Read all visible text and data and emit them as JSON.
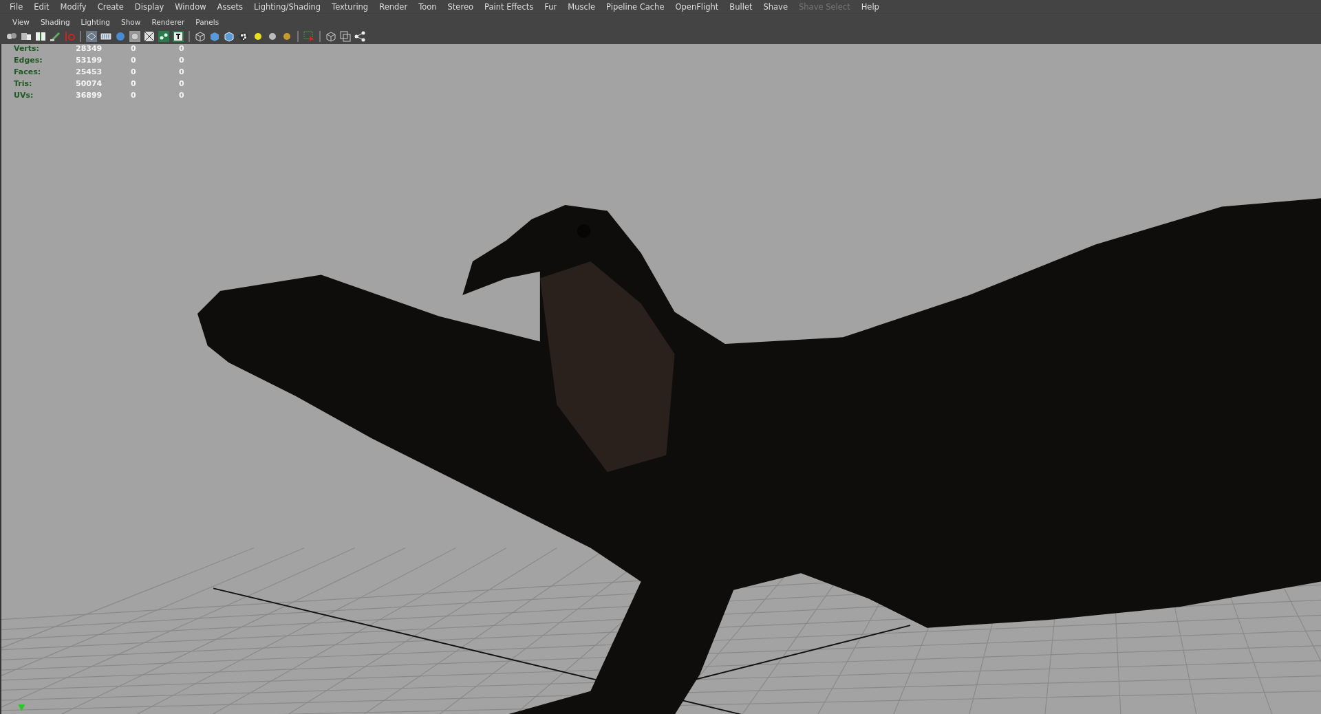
{
  "menu_bar": [
    {
      "label": "File",
      "disabled": false
    },
    {
      "label": "Edit",
      "disabled": false
    },
    {
      "label": "Modify",
      "disabled": false
    },
    {
      "label": "Create",
      "disabled": false
    },
    {
      "label": "Display",
      "disabled": false
    },
    {
      "label": "Window",
      "disabled": false
    },
    {
      "label": "Assets",
      "disabled": false
    },
    {
      "label": "Lighting/Shading",
      "disabled": false
    },
    {
      "label": "Texturing",
      "disabled": false
    },
    {
      "label": "Render",
      "disabled": false
    },
    {
      "label": "Toon",
      "disabled": false
    },
    {
      "label": "Stereo",
      "disabled": false
    },
    {
      "label": "Paint Effects",
      "disabled": false
    },
    {
      "label": "Fur",
      "disabled": false
    },
    {
      "label": "Muscle",
      "disabled": false
    },
    {
      "label": "Pipeline Cache",
      "disabled": false
    },
    {
      "label": "OpenFlight",
      "disabled": false
    },
    {
      "label": "Bullet",
      "disabled": false
    },
    {
      "label": "Shave",
      "disabled": false
    },
    {
      "label": "Shave Select",
      "disabled": true
    },
    {
      "label": "Help",
      "disabled": false
    }
  ],
  "panel_menu": [
    "View",
    "Shading",
    "Lighting",
    "Show",
    "Renderer",
    "Panels"
  ],
  "stats": [
    {
      "label": "Verts:",
      "values": [
        "28349",
        "0",
        "0"
      ]
    },
    {
      "label": "Edges:",
      "values": [
        "53199",
        "0",
        "0"
      ]
    },
    {
      "label": "Faces:",
      "values": [
        "25453",
        "0",
        "0"
      ]
    },
    {
      "label": "Tris:",
      "values": [
        "50074",
        "0",
        "0"
      ]
    },
    {
      "label": "UVs:",
      "values": [
        "36899",
        "0",
        "0"
      ]
    }
  ]
}
